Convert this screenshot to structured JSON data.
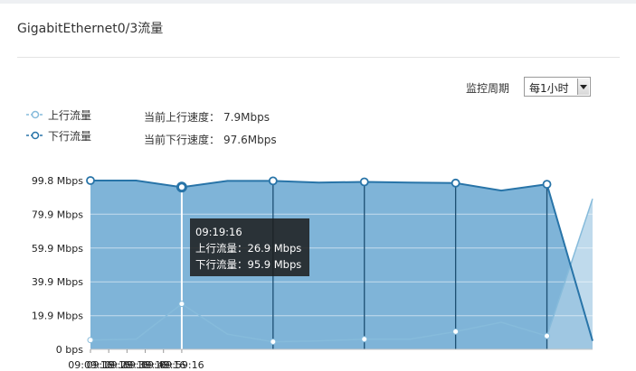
{
  "page": {
    "title": "GigabitEthernet0/3流量"
  },
  "controls": {
    "period_label": "监控周期",
    "period_value": "每1小时"
  },
  "legend": {
    "upload": "上行流量",
    "download": "下行流量"
  },
  "current": {
    "upload_label": "当前上行速度：",
    "upload_value": "7.9Mbps",
    "download_label": "当前下行速度：",
    "download_value": "97.6Mbps"
  },
  "tooltip": {
    "time": "09:19:16",
    "upload": "上行流量：26.9 Mbps",
    "download": "下行流量：95.9 Mbps"
  },
  "colors": {
    "download_fill": "#7fb4d8",
    "download_line": "#2874a8",
    "upload_line": "#86bbdb",
    "upload_fill": "#a9cde6",
    "grid": "#ffffff"
  },
  "chart_data": {
    "type": "area",
    "ylim": [
      0,
      99.8
    ],
    "y_ticks": [
      "0 bps",
      "19.9 Mbps",
      "39.9 Mbps",
      "59.9 Mbps",
      "79.9 Mbps",
      "99.8 Mbps"
    ],
    "x_ticks": [
      "09:09:16",
      "09:19:16",
      "09:29:16",
      "09:39:16",
      "09:49:16",
      "09:59:16"
    ],
    "series": [
      {
        "name": "下行流量",
        "points": [
          [
            0,
            99.8
          ],
          [
            5,
            99.8
          ],
          [
            10,
            95.9
          ],
          [
            15,
            99.6
          ],
          [
            20,
            99.6
          ],
          [
            25,
            98.6
          ],
          [
            30,
            99.0
          ],
          [
            35,
            98.6
          ],
          [
            40,
            98.3
          ],
          [
            45,
            93.9
          ],
          [
            50,
            97.6
          ],
          [
            55,
            5.0
          ]
        ]
      },
      {
        "name": "上行流量",
        "points": [
          [
            0,
            5.5
          ],
          [
            5,
            6.0
          ],
          [
            10,
            26.9
          ],
          [
            15,
            9.0
          ],
          [
            20,
            4.5
          ],
          [
            25,
            5.0
          ],
          [
            30,
            6.0
          ],
          [
            35,
            6.0
          ],
          [
            40,
            10.5
          ],
          [
            45,
            16.0
          ],
          [
            50,
            7.9
          ],
          [
            55,
            89.0
          ]
        ]
      }
    ]
  }
}
